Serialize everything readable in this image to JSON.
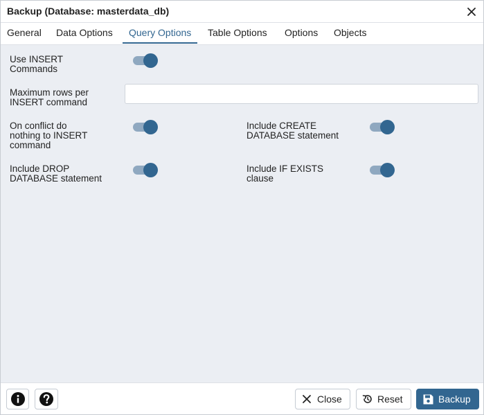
{
  "dialog": {
    "title": "Backup (Database: masterdata_db)"
  },
  "tabs": [
    {
      "label": "General"
    },
    {
      "label": "Data Options"
    },
    {
      "label": "Query Options"
    },
    {
      "label": "Table Options"
    },
    {
      "label": "Options"
    },
    {
      "label": "Objects"
    }
  ],
  "active_tab": "Query Options",
  "fields": {
    "use_insert": {
      "label_line1": "Use INSERT",
      "label_line2": "Commands",
      "enabled": true
    },
    "max_rows": {
      "label_line1": "Maximum rows per",
      "label_line2": "INSERT command",
      "value": ""
    },
    "on_conflict": {
      "label_line1": "On conflict do",
      "label_line2": "nothing to INSERT",
      "label_line3": "command",
      "enabled": true
    },
    "include_create": {
      "label_line1": "Include CREATE",
      "label_line2": "DATABASE statement",
      "enabled": true
    },
    "include_drop": {
      "label_line1": "Include DROP",
      "label_line2": "DATABASE statement",
      "enabled": true
    },
    "include_if_exists": {
      "label_line1": "Include IF EXISTS",
      "label_line2": "clause",
      "enabled": true
    }
  },
  "footer": {
    "close_label": "Close",
    "reset_label": "Reset",
    "backup_label": "Backup"
  },
  "icons": {
    "close": "close-icon",
    "info": "info-icon",
    "help": "help-icon",
    "reset": "reset-icon",
    "save": "save-icon"
  },
  "colors": {
    "accent": "#326690",
    "toggle_track": "#8fa8c0",
    "background": "#ebeef3"
  }
}
